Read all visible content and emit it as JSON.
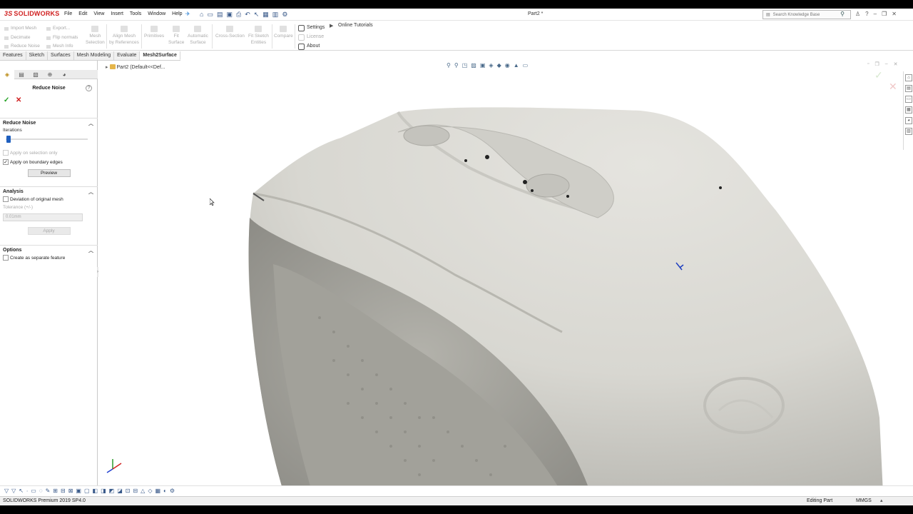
{
  "app": {
    "logo": "SOLIDWORKS",
    "logo_mark": "3S",
    "doc_title": "Part2 *"
  },
  "menu": [
    "File",
    "Edit",
    "View",
    "Insert",
    "Tools",
    "Window",
    "Help"
  ],
  "search": {
    "placeholder": "Search Knowledge Base"
  },
  "command_manager": {
    "col1": [
      "Import Mesh",
      "Decimate",
      "Reduce Noise"
    ],
    "col2": [
      "Export...",
      "Flip normals",
      "Mesh Info"
    ],
    "buttons": [
      {
        "line1": "Mesh",
        "line2": "Selection"
      },
      {
        "line1": "Align Mesh",
        "line2": "by References"
      },
      {
        "line1": "Primitives",
        "line2": ""
      },
      {
        "line1": "Fit",
        "line2": "Surface"
      },
      {
        "line1": "Automatic",
        "line2": "Surface"
      },
      {
        "line1": "Cross-Section",
        "line2": ""
      },
      {
        "line1": "Fit Sketch",
        "line2": "Entities"
      },
      {
        "line1": "Compare",
        "line2": ""
      }
    ],
    "settings": "Settings",
    "license": "License",
    "about": "About",
    "online_tutorials": "Online Tutorials"
  },
  "tabs": [
    "Features",
    "Sketch",
    "Surfaces",
    "Mesh Modeling",
    "Evaluate",
    "Mesh2Surface"
  ],
  "active_tab": "Mesh2Surface",
  "panel": {
    "title": "Reduce Noise",
    "reduce_noise": {
      "header": "Reduce Noise",
      "iterations_label": "Iterations",
      "iterations_value": 0,
      "apply_selection": "Apply on selection only",
      "apply_boundary": "Apply on boundary edges",
      "preview": "Preview"
    },
    "analysis": {
      "header": "Analysis",
      "deviation": "Deviation of original mesh",
      "tolerance_label": "Tolerance (+/-)",
      "tolerance_value": "0.01mm",
      "apply": "Apply"
    },
    "options": {
      "header": "Options",
      "separate": "Create as separate feature"
    }
  },
  "tree": {
    "item": "Part2  (Default<<Def..."
  },
  "status": {
    "product": "SOLIDWORKS Premium 2019 SP4.0",
    "mode": "Editing Part",
    "units": "MMGS"
  },
  "colors": {
    "logo": "#d02020",
    "accent": "#1f5fbf",
    "mesh": "#d9d8d2"
  }
}
